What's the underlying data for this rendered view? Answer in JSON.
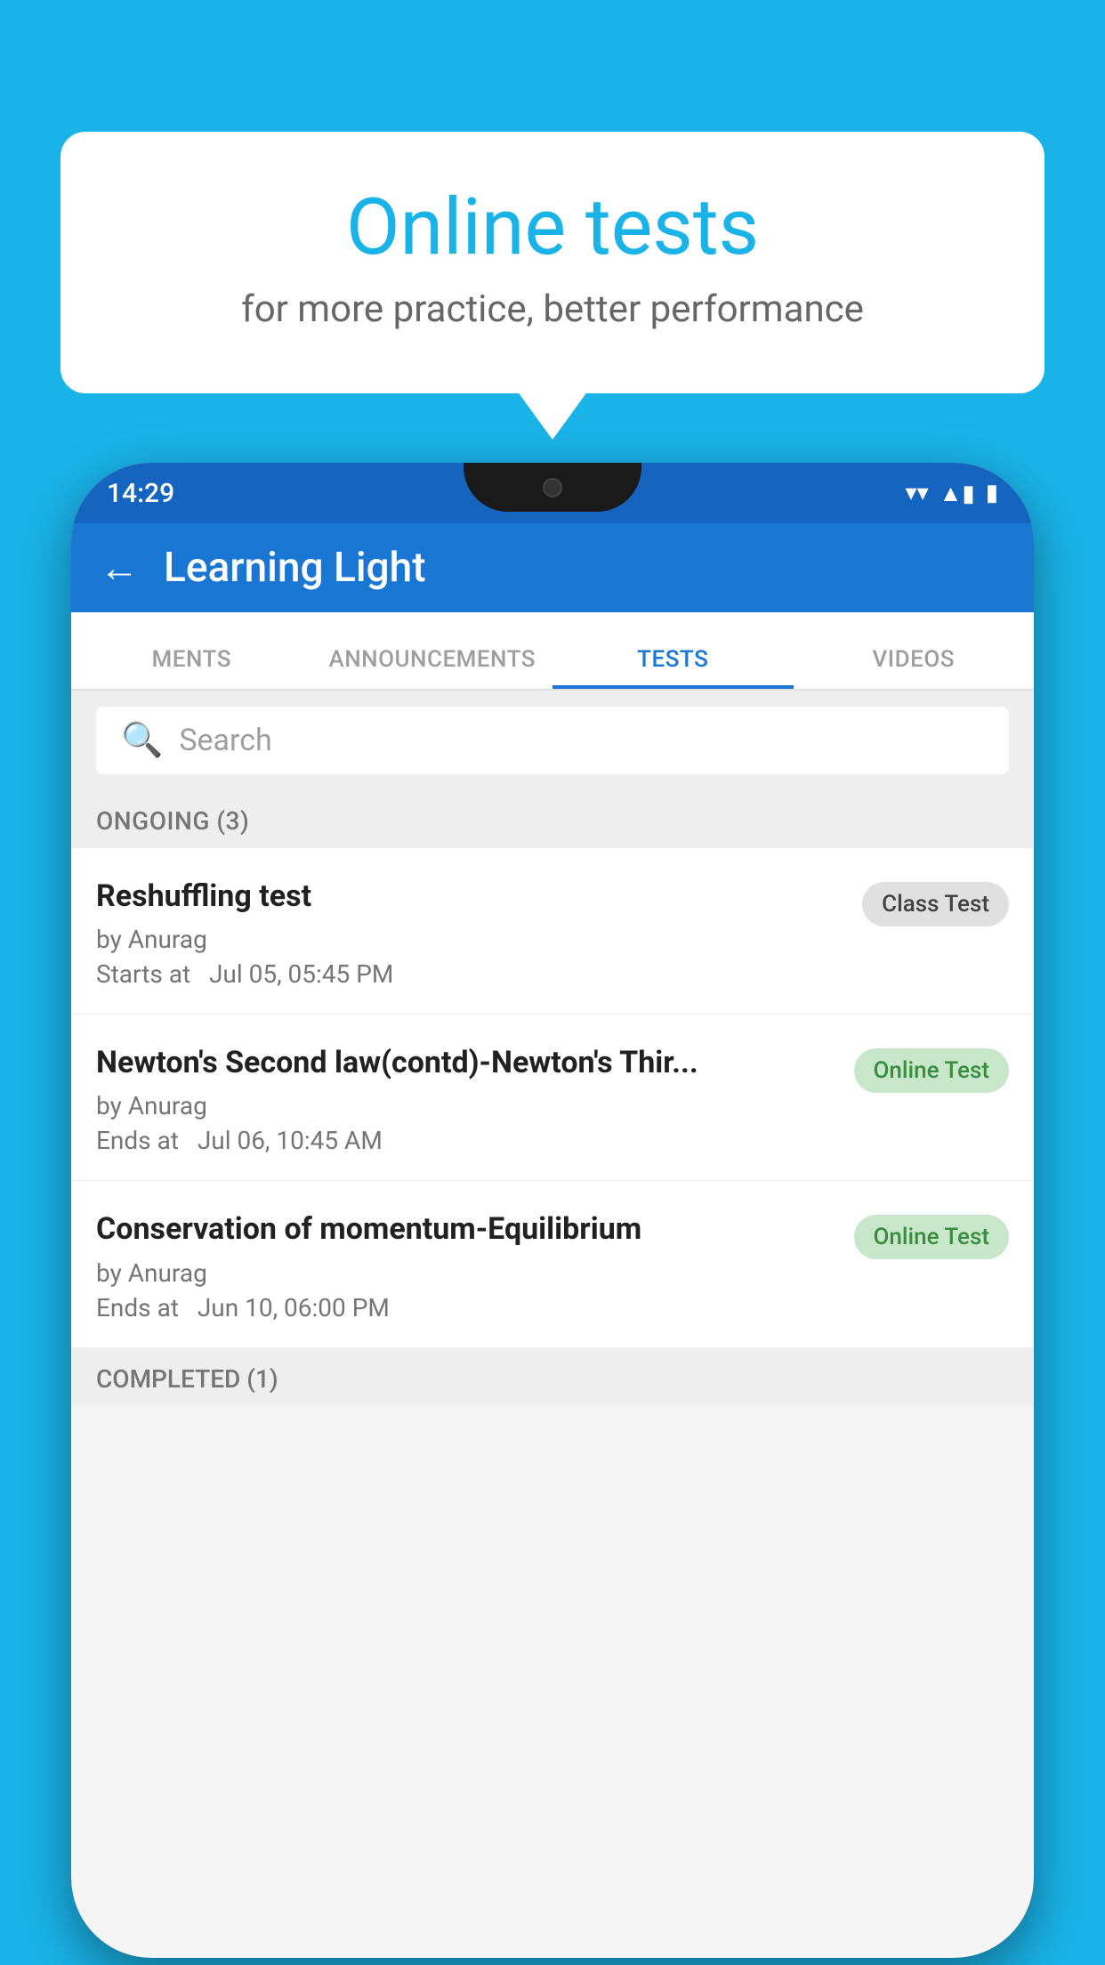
{
  "background_color": "#1ab3e8",
  "bubble": {
    "title": "Online tests",
    "subtitle": "for more practice, better performance"
  },
  "phone": {
    "status_bar": {
      "time": "14:29",
      "icons": [
        "▼",
        "▲",
        "▮"
      ]
    },
    "app_bar": {
      "back_label": "←",
      "title": "Learning Light"
    },
    "tabs": [
      {
        "label": "MENTS",
        "active": false
      },
      {
        "label": "ANNOUNCEMENTS",
        "active": false
      },
      {
        "label": "TESTS",
        "active": true
      },
      {
        "label": "VIDEOS",
        "active": false
      }
    ],
    "search": {
      "placeholder": "Search",
      "icon": "🔍"
    },
    "section_ongoing": {
      "label": "ONGOING (3)"
    },
    "tests": [
      {
        "name": "Reshuffling test",
        "author": "by Anurag",
        "time_label": "Starts at",
        "time": "Jul 05, 05:45 PM",
        "badge": "Class Test",
        "badge_type": "class"
      },
      {
        "name": "Newton's Second law(contd)-Newton's Thir...",
        "author": "by Anurag",
        "time_label": "Ends at",
        "time": "Jul 06, 10:45 AM",
        "badge": "Online Test",
        "badge_type": "online"
      },
      {
        "name": "Conservation of momentum-Equilibrium",
        "author": "by Anurag",
        "time_label": "Ends at",
        "time": "Jun 10, 06:00 PM",
        "badge": "Online Test",
        "badge_type": "online"
      }
    ],
    "section_completed": {
      "label": "COMPLETED (1)"
    }
  }
}
